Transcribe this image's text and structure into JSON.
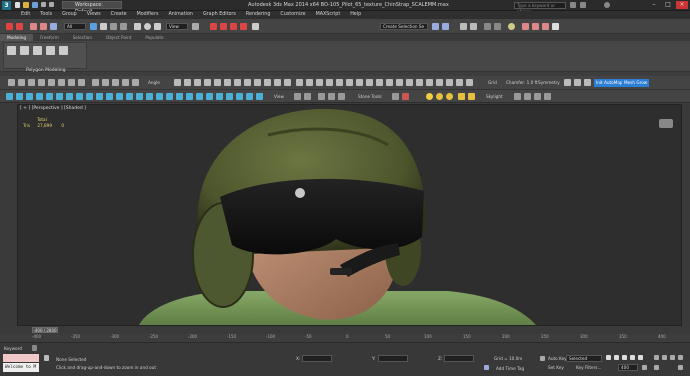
{
  "window": {
    "logo_text": "3",
    "workspace_label": "Workspace: Default",
    "caption": "Autodesk 3ds Max 2014 x64    BO-105_Pilot_65_texture_ChinStrap_SCALEMM.max",
    "search_placeholder": "Type a keyword or phrase",
    "min_icon": "minimize-icon",
    "max_icon": "maximize-icon",
    "close_icon": "close-icon"
  },
  "menu": [
    "Edit",
    "Tools",
    "Group",
    "Views",
    "Create",
    "Modifiers",
    "Animation",
    "Graph Editors",
    "Rendering",
    "Customize",
    "MAXScript",
    "Help"
  ],
  "toolbar1": {
    "filter_value": "All",
    "view_value": "View",
    "create_selection_value": "Create Selection Se"
  },
  "ribbon": {
    "tabs": [
      "Modeling",
      "Freeform",
      "Selection",
      "Object Paint",
      "Populate"
    ],
    "active_tab": "Modeling",
    "panel_label": "Polygon Modeling"
  },
  "toolbar2": {
    "angle_label": "Angle",
    "grid_label": "Grid",
    "chamfer_label": "Chamfer: 1.0 ft",
    "symmetry_label": "Symmetry",
    "auto_mapping_label": "Init AutoMapping",
    "mesh_grow_label": "Mesh Grow"
  },
  "toolbar3": {
    "view_label": "View",
    "stone_tools_label": "Stone Tools",
    "skylight_label": "Skylight"
  },
  "viewport": {
    "label": "[ + ] [Perspective ] [Shaded ]",
    "stats_title": "Total",
    "stats_tris_label": "Tris",
    "stats_tris_value": "27,899",
    "stats_tris_sel": "0"
  },
  "timeline": {
    "frame_indicator": "-400 / 2800",
    "ticks": [
      "-400",
      "-350",
      "-300",
      "-250",
      "-200",
      "-150",
      "-100",
      "-50",
      "0",
      "50",
      "100",
      "150",
      "200",
      "250",
      "300",
      "350",
      "400"
    ]
  },
  "status": {
    "welcome": "Welcome to M",
    "selection": "None Selected",
    "prompt": "Click and drag-up-and-down to zoom in and out",
    "script_label": "Keyword",
    "x_label": "X:",
    "y_label": "Y:",
    "z_label": "Z:",
    "grid_label": "Grid = 10.0m",
    "add_time_tag": "Add Time Tag",
    "auto_key": "Auto Key",
    "set_key": "Set Key",
    "selected_value": "Selected",
    "key_filters": "Key Filters...",
    "frame_value": "400"
  },
  "colors": {
    "viewport_bg": "#2e2e2e",
    "helmet": "#5a6336",
    "visor": "#141414",
    "skin": "#b88a6e",
    "shirt": "#7a9a5c",
    "accent": "#2d7fd6"
  }
}
